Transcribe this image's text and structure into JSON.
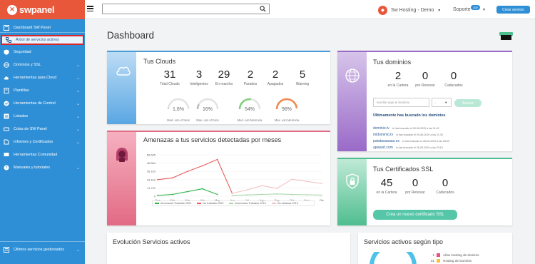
{
  "logo": {
    "text": "swpanel"
  },
  "sidebar": {
    "items": [
      {
        "label": "Dashboard SW Panel",
        "icon": "home-icon",
        "chevron": false
      },
      {
        "label": "Árbol de servicios activos",
        "icon": "tree-icon",
        "chevron": false
      },
      {
        "label": "Seguridad",
        "icon": "shield-icon",
        "chevron": false
      },
      {
        "label": "Dominios y SSL",
        "icon": "globe-icon",
        "chevron": true
      },
      {
        "label": "Herramientas para Cloud",
        "icon": "cloud-icon",
        "chevron": true
      },
      {
        "label": "Plantillas",
        "icon": "template-icon",
        "chevron": true
      },
      {
        "label": "Herramientas de Control",
        "icon": "check-circle-icon",
        "chevron": true
      },
      {
        "label": "Listados",
        "icon": "list-icon",
        "chevron": true
      },
      {
        "label": "Colas de SW Panel",
        "icon": "queue-icon",
        "chevron": true
      },
      {
        "label": "Informes y Certificados",
        "icon": "report-icon",
        "chevron": true
      },
      {
        "label": "Herramientas Comunidad",
        "icon": "community-icon",
        "chevron": false
      },
      {
        "label": "Manuales y tutoriales",
        "icon": "help-icon",
        "chevron": true
      }
    ],
    "bottom": {
      "label": "Últimos servicios gestionados"
    }
  },
  "topbar": {
    "search_placeholder": "",
    "account": "Sw Hosting - Demo",
    "support": "Soporte",
    "support_badge": "100",
    "new_service": "Crear servicio"
  },
  "page": {
    "title": "Dashboard"
  },
  "clouds": {
    "title": "Tus Clouds",
    "stats": [
      {
        "value": "31",
        "label": "Total Clouds"
      },
      {
        "value": "3",
        "label": "Inteligentes"
      },
      {
        "value": "29",
        "label": "En marcha"
      },
      {
        "value": "2",
        "label": "Parados"
      },
      {
        "value": "2",
        "label": "Apagados"
      },
      {
        "value": "5",
        "label": "Warning"
      }
    ],
    "gauges": [
      {
        "pct": "1,6%",
        "value": 1.6,
        "label": "Med. uso vCores",
        "color": "#bbbbbb"
      },
      {
        "pct": "16%",
        "value": 16,
        "label": "Max. uso vCores",
        "color": "#bbbbbb"
      },
      {
        "pct": "54%",
        "value": 54,
        "label": "Med. uso Memoria",
        "color": "#7fd07a"
      },
      {
        "pct": "96%",
        "value": 96,
        "label": "Max. uso Memoria",
        "color": "#f0874f"
      }
    ]
  },
  "threats": {
    "title": "Amenazas a tus servicios detectadas por meses",
    "legend": [
      "Amenazas Tratadas 2020",
      "No tratadas 2020",
      "Amenazas Tratadas 2019",
      "No tratadas 2019"
    ]
  },
  "chart_data": {
    "type": "line",
    "categories": [
      "Ene",
      "Feb",
      "Mar",
      "Abr",
      "May",
      "Jun",
      "Jul",
      "Ago",
      "Sep",
      "Oct",
      "Nov",
      "Dic"
    ],
    "yticks": [
      "58.605",
      "46.884",
      "35.163",
      "23.442",
      "11.721",
      "0"
    ],
    "ylim": [
      0,
      58605
    ],
    "series": [
      {
        "name": "Amenazas Tratadas 2020",
        "color": "#2cb34a",
        "values": [
          1200,
          2500,
          6500,
          10500,
          2500,
          null,
          null,
          null,
          null,
          null,
          null,
          null
        ]
      },
      {
        "name": "No tratadas 2020",
        "color": "#e85c5c",
        "values": [
          23442,
          26000,
          35163,
          43000,
          52000,
          4000,
          null,
          null,
          null,
          null,
          null,
          null
        ]
      },
      {
        "name": "Amenazas Tratadas 2019",
        "color": "#a9d6a9",
        "values": [
          null,
          null,
          null,
          null,
          null,
          1200,
          1800,
          2500,
          3200,
          2500,
          2000,
          1600
        ]
      },
      {
        "name": "No tratadas 2019",
        "color": "#f3c2c2",
        "values": [
          null,
          null,
          null,
          null,
          null,
          4000,
          9000,
          15000,
          11000,
          24000,
          21000,
          18000
        ]
      }
    ]
  },
  "domains": {
    "title": "Tus dominios",
    "stats": [
      {
        "value": "2",
        "label": "en la Cartera"
      },
      {
        "value": "0",
        "label": "por Renovar"
      },
      {
        "value": "0",
        "label": "Caducados"
      }
    ],
    "input_placeholder": "escribe aquí el dominio",
    "select_value": ".",
    "search_btn": "Buscar",
    "recent_title": "Últimamente has buscado los dominios",
    "recent": [
      {
        "domain": "dominio.tv",
        "note": "lo has buscado el 05-06-2020 a las 11:49"
      },
      {
        "domain": "midominio.tv",
        "note": "lo has buscado el 05-06-2020 a las 11:39"
      },
      {
        "domain": "patatasaaaaa.es",
        "note": "lo has buscado el 28-05-2020 a las 08:59"
      },
      {
        "domain": "apepart.com",
        "note": "lo has buscado el 26-05-2020 a las 20:15"
      }
    ]
  },
  "ssl": {
    "title": "Tus Certificados SSL",
    "stats": [
      {
        "value": "45",
        "label": "en la Cartera"
      },
      {
        "value": "0",
        "label": "por Renovar"
      },
      {
        "value": "0",
        "label": "Caducados"
      }
    ],
    "button": "Crea un nuevo certificado SSL"
  },
  "evolution": {
    "title": "Evolución Servicios activos"
  },
  "services_type": {
    "title": "Servicios activos según tipo",
    "items": [
      {
        "count": "1",
        "label": "Alias Hosting de dominio",
        "color": "#e84f8a"
      },
      {
        "count": "31",
        "label": "Hosting de Dominio",
        "color": "#f5c542"
      }
    ]
  }
}
